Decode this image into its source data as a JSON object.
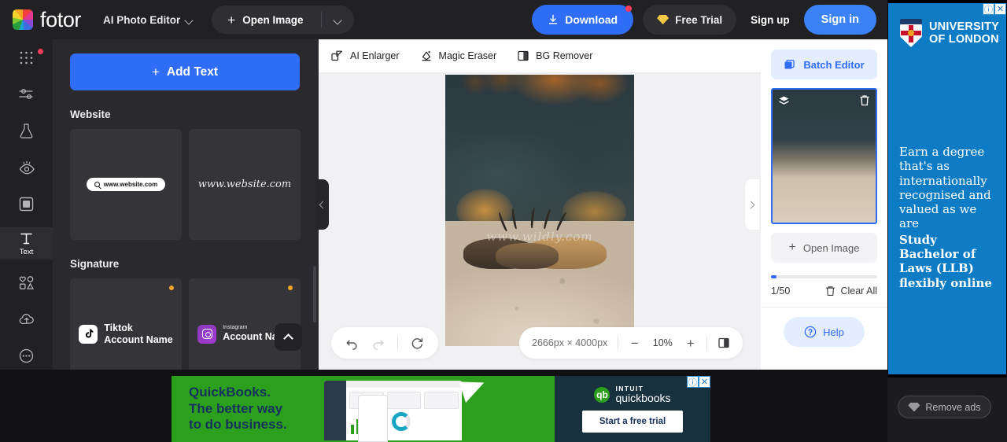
{
  "topbar": {
    "brand": "fotor",
    "mode": "AI Photo Editor",
    "open_image": "Open Image",
    "download": "Download",
    "free_trial": "Free Trial",
    "sign_up": "Sign up",
    "sign_in": "Sign in",
    "accent": "#2f6df6",
    "background": "#212124"
  },
  "rail": {
    "items": [
      {
        "label": "",
        "icon": "apps-grid-icon",
        "name": "templates"
      },
      {
        "label": "",
        "icon": "sliders-icon",
        "name": "adjust"
      },
      {
        "label": "",
        "icon": "flask-icon",
        "name": "ai-tools"
      },
      {
        "label": "",
        "icon": "eye-retouch-icon",
        "name": "retouch"
      },
      {
        "label": "",
        "icon": "frame-icon",
        "name": "frame"
      },
      {
        "label": "Text",
        "icon": "text-icon",
        "name": "text"
      },
      {
        "label": "",
        "icon": "elements-icon",
        "name": "elements"
      },
      {
        "label": "",
        "icon": "cloud-upload-icon",
        "name": "uploads"
      },
      {
        "label": "",
        "icon": "more-dots-icon",
        "name": "more"
      }
    ],
    "active_index": 5
  },
  "panel": {
    "add_text": "Add Text",
    "sections": [
      {
        "title": "Website",
        "cards": [
          {
            "kind": "search-pill",
            "text": "www.website.com",
            "pro": false
          },
          {
            "kind": "script",
            "text": "www.website.com",
            "pro": false
          }
        ]
      },
      {
        "title": "Signature",
        "cards": [
          {
            "kind": "tiktok",
            "small": "",
            "text": "Tiktok",
            "text2": "Account Name",
            "pro": true
          },
          {
            "kind": "instagram",
            "small": "Instagram",
            "text2": "Account Name",
            "pro": true
          }
        ]
      }
    ]
  },
  "canvas": {
    "tools": [
      {
        "label": "AI Enlarger",
        "icon": "enlarge-icon"
      },
      {
        "label": "Magic Eraser",
        "icon": "eraser-icon"
      },
      {
        "label": "BG Remover",
        "icon": "bg-remover-icon"
      }
    ],
    "watermark": "www.wildly.com",
    "dimensions": "2666px × 4000px",
    "zoom": "10%",
    "undo": "undo-icon",
    "redo": "redo-icon",
    "reset": "reset-icon",
    "compare": "compare-icon",
    "zoom_out": "−",
    "zoom_in": "+",
    "collapse_left": "‹",
    "collapse_right": "›"
  },
  "right_panel": {
    "batch_editor": "Batch Editor",
    "open_image": "Open Image",
    "count": "1/50",
    "clear_all": "Clear All",
    "help": "Help",
    "layers_icon": "layers-icon",
    "delete_icon": "trash-icon",
    "accent": "#2f6df6"
  },
  "ads": {
    "right": {
      "brand_line1": "UNIVERSITY",
      "brand_line2": "OF LONDON",
      "body": "Earn a degree that's as internationally recognised and valued as we are",
      "cta": "Study Bachelor of Laws (LLB) flexibly online",
      "background": "#0d7cc4",
      "info_icon": "ⓘ",
      "close_icon": "✕"
    },
    "bottom": {
      "headline_l1": "QuickBooks.",
      "headline_l2": "The better way",
      "headline_l3": "to do business.",
      "brand_top": "INTUIT",
      "brand_bottom": "quickbooks",
      "cta": "Start a free trial",
      "green": "#2ca01c",
      "dark": "#17313f",
      "info_icon": "ⓘ",
      "close_icon": "✕"
    },
    "remove_ads": "Remove ads"
  }
}
